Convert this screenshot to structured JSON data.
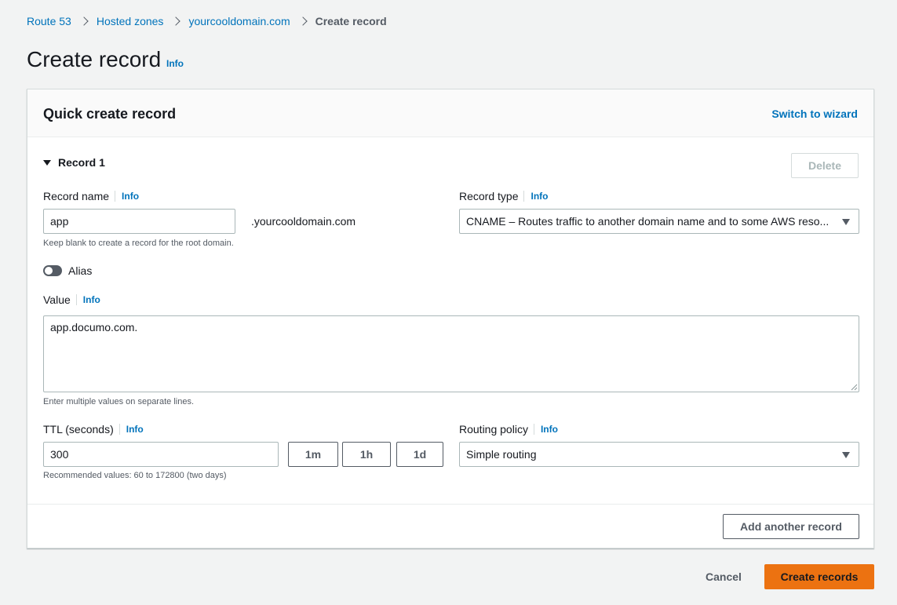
{
  "breadcrumb": {
    "items": [
      "Route 53",
      "Hosted zones",
      "yourcooldomain.com"
    ],
    "current": "Create record"
  },
  "page": {
    "title": "Create record",
    "info": "Info"
  },
  "panel": {
    "title": "Quick create record",
    "switch_wizard": "Switch to wizard"
  },
  "record": {
    "heading": "Record 1",
    "delete_label": "Delete",
    "name_label": "Record name",
    "name_info": "Info",
    "name_value": "app",
    "domain_suffix": ".yourcooldomain.com",
    "name_hint": "Keep blank to create a record for the root domain.",
    "type_label": "Record type",
    "type_info": "Info",
    "type_value": "CNAME – Routes traffic to another domain name and to some AWS reso...",
    "alias_label": "Alias",
    "value_label": "Value",
    "value_info": "Info",
    "value_text": "app.documo.com.",
    "value_hint": "Enter multiple values on separate lines.",
    "ttl_label": "TTL (seconds)",
    "ttl_info": "Info",
    "ttl_value": "300",
    "ttl_buttons": [
      "1m",
      "1h",
      "1d"
    ],
    "ttl_hint": "Recommended values: 60 to 172800 (two days)",
    "routing_label": "Routing policy",
    "routing_info": "Info",
    "routing_value": "Simple routing"
  },
  "actions": {
    "add_another": "Add another record",
    "cancel": "Cancel",
    "create": "Create records"
  },
  "colors": {
    "link": "#0073bb",
    "primary": "#ec7211",
    "background": "#f2f3f3"
  }
}
